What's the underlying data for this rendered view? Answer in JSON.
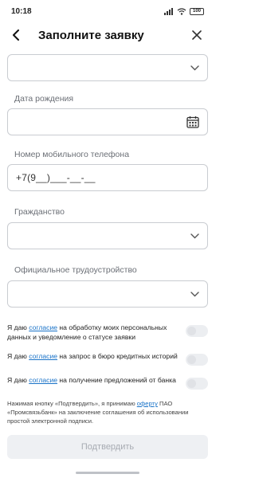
{
  "status_bar": {
    "time": "10:18",
    "battery": "100"
  },
  "header": {
    "title": "Заполните заявку"
  },
  "fields": {
    "top_select": {
      "value": ""
    },
    "birth_date": {
      "label": "Дата рождения",
      "value": ""
    },
    "phone": {
      "label": "Номер мобильного телефона",
      "value": "+7(9__)___-__-__"
    },
    "citizenship": {
      "label": "Гражданство",
      "value": ""
    },
    "employment": {
      "label": "Официальное трудоустройство",
      "value": ""
    }
  },
  "consents": [
    {
      "prefix": "Я даю ",
      "link": "согласие",
      "suffix": " на обработку моих персональных данных и уведомление о статусе заявки",
      "checked": false
    },
    {
      "prefix": "Я даю ",
      "link": "согласие",
      "suffix": " на запрос в бюро кредитных историй",
      "checked": false
    },
    {
      "prefix": "Я даю ",
      "link": "согласие",
      "suffix": " на получение предложений от банка",
      "checked": false
    }
  ],
  "legal": {
    "prefix": "Нажимая кнопку «Подтвердить», я принимаю ",
    "link": "оферту",
    "suffix": " ПАО «Промсвязьбанк» на заключение соглашения об использовании простой электронной подписи."
  },
  "submit_label": "Подтвердить"
}
